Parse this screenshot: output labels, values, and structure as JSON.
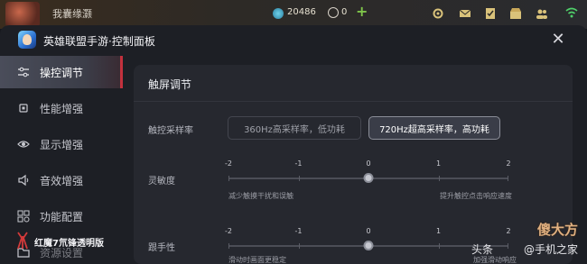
{
  "game": {
    "player_name": "我囊缘灏",
    "currency_value": "20486",
    "secondary_value": "0"
  },
  "panel": {
    "title": "英雄联盟手游·控制面板",
    "close_symbol": "✕"
  },
  "sidebar": {
    "items": [
      {
        "label": "操控调节",
        "icon": "sliders-icon",
        "active": true
      },
      {
        "label": "性能增强",
        "icon": "chip-icon",
        "active": false
      },
      {
        "label": "显示增强",
        "icon": "eye-icon",
        "active": false
      },
      {
        "label": "音效增强",
        "icon": "speaker-icon",
        "active": false
      },
      {
        "label": "功能配置",
        "icon": "grid-icon",
        "active": false
      },
      {
        "label": "资源设置",
        "icon": "folder-icon",
        "active": false
      }
    ],
    "brand": "红魔7氘锋透明版"
  },
  "touch": {
    "section_title": "触屏调节",
    "sample_rate": {
      "label": "触控采样率",
      "options": [
        "360Hz高采样率，低功耗",
        "720Hz超高采样率，高功耗"
      ],
      "selected_index": 1
    },
    "sensitivity": {
      "label": "灵敏度",
      "ticks": [
        "-2",
        "-1",
        "0",
        "1",
        "2"
      ],
      "value": 0,
      "hint_left": "减少触摸干扰和误触",
      "hint_right": "提升触控点击响应速度"
    },
    "follow": {
      "label": "跟手性",
      "ticks": [
        "-2",
        "-1",
        "0",
        "1",
        "2"
      ],
      "value": 0,
      "hint_left": "滑动时画面更稳定",
      "hint_right": "加强滑动响应"
    }
  },
  "watermark": {
    "main": "傻大方",
    "sub_left": "头条",
    "sub_right": "@手机之家"
  },
  "colors": {
    "accent_red": "#c3313d",
    "panel_bg": "#1d1f25",
    "card_bg": "#26282f"
  }
}
